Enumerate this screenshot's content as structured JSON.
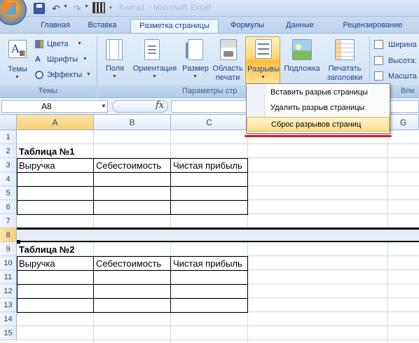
{
  "window": {
    "title": "Microsoft Excel",
    "title_visible": "Книга1 - Microsoft Excel"
  },
  "tabs": [
    "Главная",
    "Вставка",
    "Разметка страницы",
    "Формулы",
    "Данные",
    "Рецензирование"
  ],
  "active_tab": "Разметка страницы",
  "ribbon": {
    "themes_group": {
      "label": "Темы",
      "big": "Темы",
      "colors": "Цвета",
      "fonts": "Шрифты",
      "effects": "Эффекты"
    },
    "page_setup_group": {
      "label": "Параметры стр",
      "fields": "Поля",
      "orientation": "Ориентация",
      "size": "Размер",
      "print_area_1": "Область",
      "print_area_2": "печати",
      "breaks": "Разрывы",
      "background": "Подложка",
      "titles_1": "Печатать",
      "titles_2": "заголовки"
    },
    "scale_group": {
      "label": "Впи",
      "width": "Ширина",
      "height": "Высота:",
      "scale": "Масшта"
    }
  },
  "breaks_menu": {
    "items": [
      "Вставить разрыв страницы",
      "Удалить разрыв страницы",
      "Сброс разрывов страниц"
    ],
    "highlighted_index": 2
  },
  "formula_bar": {
    "name_box": "A8",
    "fx": "fx",
    "value": ""
  },
  "columns": [
    "A",
    "B",
    "C",
    "G"
  ],
  "rows": [
    "1",
    "2",
    "3",
    "4",
    "5",
    "6",
    "7",
    "8",
    "9",
    "10",
    "11",
    "12",
    "13",
    "14",
    "15"
  ],
  "sheet": {
    "t1_title": "Таблица №1",
    "t1_h1": "Выручка",
    "t1_h2": "Себестоимость",
    "t1_h3": "Чистая прибыль",
    "t2_title": "Таблица №2",
    "t2_h1": "Выручка",
    "t2_h2": "Себестоимость",
    "t2_h3": "Чистая прибыль"
  },
  "colors": {
    "accent_underline": "#d61c2b",
    "menu_highlight": "#ffe08e",
    "ribbon_bg": "#d6e5f6"
  }
}
